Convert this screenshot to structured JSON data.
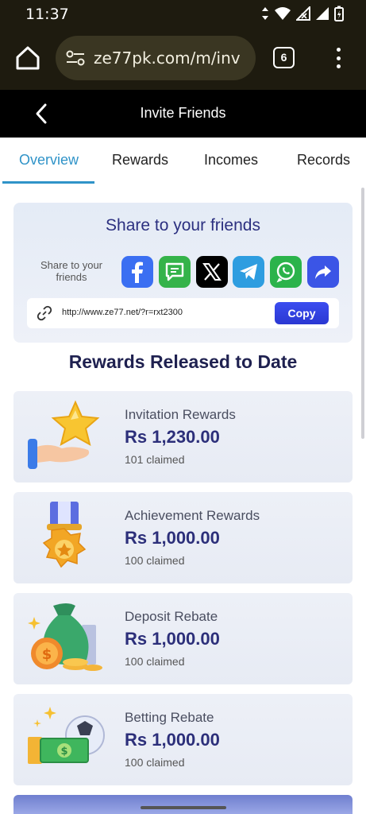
{
  "status_bar": {
    "time": "11:37"
  },
  "browser": {
    "url": "ze77pk.com/m/inv",
    "tab_count": "6"
  },
  "header": {
    "title": "Invite Friends"
  },
  "tabs": [
    {
      "label": "Overview",
      "active": true
    },
    {
      "label": "Rewards",
      "active": false
    },
    {
      "label": "Incomes",
      "active": false
    },
    {
      "label": "Records",
      "active": false
    }
  ],
  "share": {
    "heading": "Share to your friends",
    "label": "Share to your friends",
    "socials": [
      {
        "icon": "facebook-icon",
        "color": "#3b6ff2"
      },
      {
        "icon": "sms-icon",
        "color": "#35b34a"
      },
      {
        "icon": "x-icon",
        "color": "#000000"
      },
      {
        "icon": "telegram-icon",
        "color": "#2e9de0"
      },
      {
        "icon": "whatsapp-icon",
        "color": "#2bb34b"
      },
      {
        "icon": "share-arrow-icon",
        "color": "#3b55e6"
      }
    ],
    "link": "http://www.ze77.net/?r=rxt2300",
    "copy_label": "Copy"
  },
  "rewards_section": {
    "title": "Rewards Released to Date",
    "cards": [
      {
        "title": "Invitation Rewards",
        "amount": "Rs 1,230.00",
        "claimed": "101 claimed",
        "icon": "star-hand-icon"
      },
      {
        "title": "Achievement Rewards",
        "amount": "Rs 1,000.00",
        "claimed": "100 claimed",
        "icon": "medal-icon"
      },
      {
        "title": "Deposit Rebate",
        "amount": "Rs 1,000.00",
        "claimed": "100 claimed",
        "icon": "money-bag-icon"
      },
      {
        "title": "Betting Rebate",
        "amount": "Rs 1,000.00",
        "claimed": "100 claimed",
        "icon": "ball-cash-icon"
      }
    ]
  },
  "colors": {
    "accent": "#2f93c8",
    "title_navy": "#2c3080",
    "copy_button": "#2f3ee0"
  }
}
